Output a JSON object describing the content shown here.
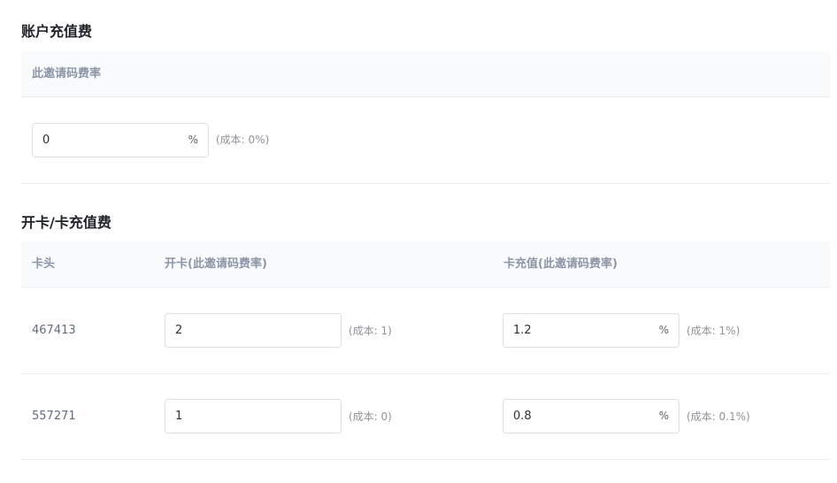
{
  "account": {
    "title": "账户充值费",
    "header": "此邀请码费率",
    "value": "0",
    "suffix": "%",
    "cost": "(成本: 0%)"
  },
  "card": {
    "title": "开卡/卡充值费",
    "headers": {
      "bin": "卡头",
      "open": "开卡(此邀请码费率)",
      "recharge": "卡充值(此邀请码费率)"
    },
    "rows": [
      {
        "bin": "467413",
        "open_value": "2",
        "open_cost": "(成本: 1)",
        "recharge_value": "1.2",
        "recharge_suffix": "%",
        "recharge_cost": "(成本: 1%)"
      },
      {
        "bin": "557271",
        "open_value": "1",
        "open_cost": "(成本: 0)",
        "recharge_value": "0.8",
        "recharge_suffix": "%",
        "recharge_cost": "(成本: 0.1%)"
      }
    ]
  }
}
